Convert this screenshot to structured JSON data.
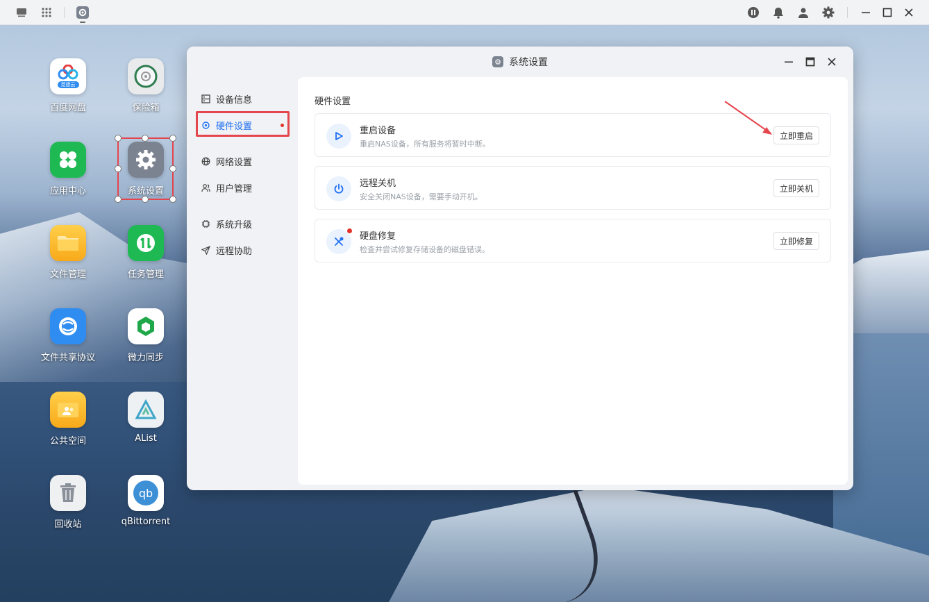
{
  "topbar": {
    "left_icons": [
      "monitor-icon",
      "apps-grid-icon",
      "settings-app-icon"
    ],
    "right_icons": [
      "fn-icon",
      "bell-icon",
      "user-icon",
      "gear-icon"
    ],
    "controls": [
      "minimize-icon",
      "maximize-icon",
      "close-icon"
    ]
  },
  "desktop": {
    "icons": [
      {
        "label": "百度网盘",
        "sub": "觅想云"
      },
      {
        "label": "保险箱"
      },
      {
        "label": "应用中心"
      },
      {
        "label": "系统设置"
      },
      {
        "label": "文件管理"
      },
      {
        "label": "任务管理"
      },
      {
        "label": "文件共享协议"
      },
      {
        "label": "微力同步"
      },
      {
        "label": "公共空间"
      },
      {
        "label": "AList"
      },
      {
        "label": "回收站"
      },
      {
        "label": "qBittorrent",
        "glyph": "qb"
      }
    ]
  },
  "window": {
    "title": "系统设置",
    "sidebar": [
      {
        "label": "设备信息",
        "icon": "device-info-icon"
      },
      {
        "label": "硬件设置",
        "icon": "hardware-icon",
        "active": true
      },
      {
        "label": "网络设置",
        "icon": "globe-icon"
      },
      {
        "label": "用户管理",
        "icon": "users-icon"
      },
      {
        "label": "系统升级",
        "icon": "chip-icon"
      },
      {
        "label": "远程协助",
        "icon": "send-icon"
      }
    ],
    "section_title": "硬件设置",
    "cards": [
      {
        "title": "重启设备",
        "desc": "重启NAS设备，所有服务将暂时中断。",
        "button": "立即重启",
        "icon": "play-icon"
      },
      {
        "title": "远程关机",
        "desc": "安全关闭NAS设备，需要手动开机。",
        "button": "立即关机",
        "icon": "power-icon"
      },
      {
        "title": "硬盘修复",
        "desc": "检查并尝试修复存储设备的磁盘错误。",
        "button": "立即修复",
        "icon": "tools-icon"
      }
    ]
  },
  "colors": {
    "accent": "#1f6ff2",
    "highlight": "#e5454d",
    "badge": "#e0332b"
  }
}
